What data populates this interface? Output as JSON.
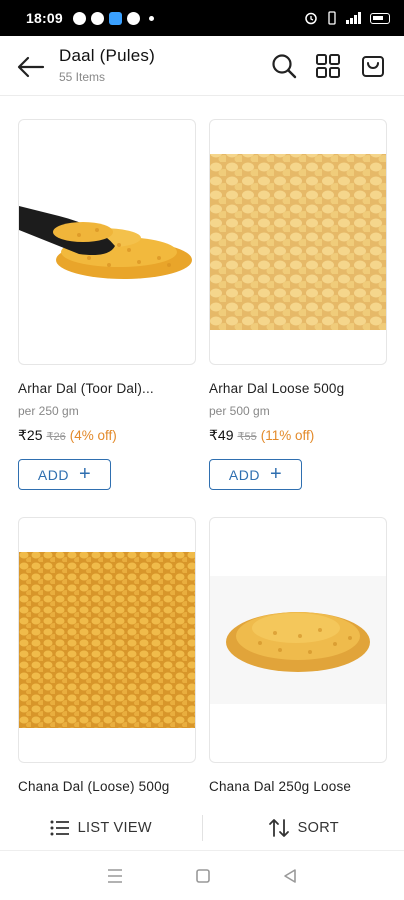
{
  "status_bar": {
    "time": "18:09"
  },
  "header": {
    "title": "Daal (Pules)",
    "subtitle": "55 Items"
  },
  "products": [
    {
      "name": "Arhar Dal (Toor Dal)...",
      "unit": "per 250 gm",
      "price": "₹25",
      "mrp": "₹26",
      "discount": "(4% off)",
      "add_label": "ADD",
      "image": "toor-dal-scoop"
    },
    {
      "name": "Arhar Dal Loose 500g",
      "unit": "per 500 gm",
      "price": "₹49",
      "mrp": "₹55",
      "discount": "(11% off)",
      "add_label": "ADD",
      "image": "arhar-dal-closeup"
    },
    {
      "name": "Chana Dal (Loose) 500g",
      "image": "chana-dal-closeup"
    },
    {
      "name": "Chana Dal 250g Loose",
      "image": "chana-dal-pile"
    }
  ],
  "action_bar": {
    "list_view": "LIST VIEW",
    "sort": "SORT"
  },
  "colors": {
    "accent_blue": "#2f6fb0",
    "discount_orange": "#e38a2a"
  }
}
